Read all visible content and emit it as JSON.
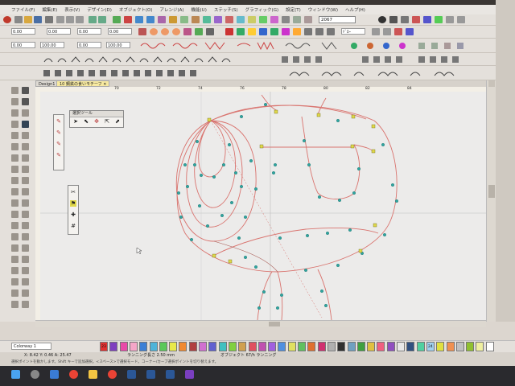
{
  "menu": {
    "items": [
      "ファイル(F)",
      "編集(E)",
      "表示(V)",
      "デザイン(D)",
      "オブジェクト(O)",
      "アレンジ(A)",
      "機能(U)",
      "ステッチ(S)",
      "グラフィック(G)",
      "設定(T)",
      "ウィンドウ(W)",
      "ヘルプ(H)"
    ]
  },
  "toolbar": {
    "row1_values": [
      "0.00",
      "0.00",
      "0.00",
      "0.00"
    ],
    "row2_values": [
      "0.00",
      "100.00",
      "0.00",
      "100.00"
    ],
    "zoom_value": "2067",
    "dropdown_value": "ﾄﾞﾛｰ"
  },
  "document_tabs": [
    {
      "label": "Design1 ✕",
      "active": false
    },
    {
      "label": "10 鋼鉄の食いモチーフ ✕",
      "active": true
    }
  ],
  "ruler_marks": [
    "70",
    "72",
    "74",
    "76",
    "78",
    "80",
    "82",
    "84"
  ],
  "select_tool_panel": {
    "title": "選択ツール"
  },
  "palette": {
    "colorway_label": "Colorway 1",
    "swatches": [
      {
        "num": "23",
        "color": "#e03030"
      },
      {
        "num": "",
        "color": "#7f3fbf"
      },
      {
        "num": "",
        "color": "#e84aa8"
      },
      {
        "num": "",
        "color": "#f4a6c8"
      },
      {
        "num": "",
        "color": "#3b7fd6"
      },
      {
        "num": "",
        "color": "#4fb3d9"
      },
      {
        "num": "",
        "color": "#5ac85a"
      },
      {
        "num": "",
        "color": "#e8e84a"
      },
      {
        "num": "",
        "color": "#f08a30"
      },
      {
        "num": "",
        "color": "#b04040"
      },
      {
        "num": "",
        "color": "#d070d0"
      },
      {
        "num": "",
        "color": "#6060d0"
      },
      {
        "num": "",
        "color": "#40c0c0"
      },
      {
        "num": "",
        "color": "#80d040"
      },
      {
        "num": "",
        "color": "#d0a050"
      },
      {
        "num": "",
        "color": "#e05060"
      },
      {
        "num": "",
        "color": "#c050b0"
      },
      {
        "num": "",
        "color": "#a060e0"
      },
      {
        "num": "",
        "color": "#5090e0"
      },
      {
        "num": "",
        "color": "#e0e060"
      },
      {
        "num": "",
        "color": "#60c060"
      },
      {
        "num": "",
        "color": "#e07030"
      },
      {
        "num": "",
        "color": "#d03070"
      },
      {
        "num": "",
        "color": "#b0b0b0"
      },
      {
        "num": "",
        "color": "#303030"
      },
      {
        "num": "",
        "color": "#70a0c0"
      },
      {
        "num": "",
        "color": "#40a040"
      },
      {
        "num": "",
        "color": "#e0c040"
      },
      {
        "num": "",
        "color": "#f06080"
      },
      {
        "num": "",
        "color": "#9050c0"
      },
      {
        "num": "",
        "color": "#e8e8e8"
      },
      {
        "num": "",
        "color": "#305080"
      },
      {
        "num": "",
        "color": "#50d0a0"
      },
      {
        "num": "24",
        "color": "#a0d0f0"
      },
      {
        "num": "",
        "color": "#e0e040"
      },
      {
        "num": "",
        "color": "#f09050"
      },
      {
        "num": "",
        "color": "#c0c0c0"
      },
      {
        "num": "",
        "color": "#90c030"
      },
      {
        "num": "",
        "color": "#f0f0a0"
      },
      {
        "num": "",
        "color": "#ffffff"
      }
    ]
  },
  "status": {
    "coords": "X: 8.42 Y: 0.46 A: 25.47",
    "stitch_info": "ランニング長さ 2.50 mm",
    "object_info": "オブジェクト 67/h ランニング"
  },
  "hint": {
    "text": "選択ポイントを動かします。Shift キーで追加選択。<スペース>で選択モード。コーナー/カーブ選択ポイントを切り替えます。"
  },
  "colors": {
    "stitch_red": "#d9736e",
    "stitch_dark": "#a85a54",
    "node_teal": "#2fa5a0",
    "node_yellow": "#e0d84a",
    "canvas_bg": "#ecebea"
  }
}
